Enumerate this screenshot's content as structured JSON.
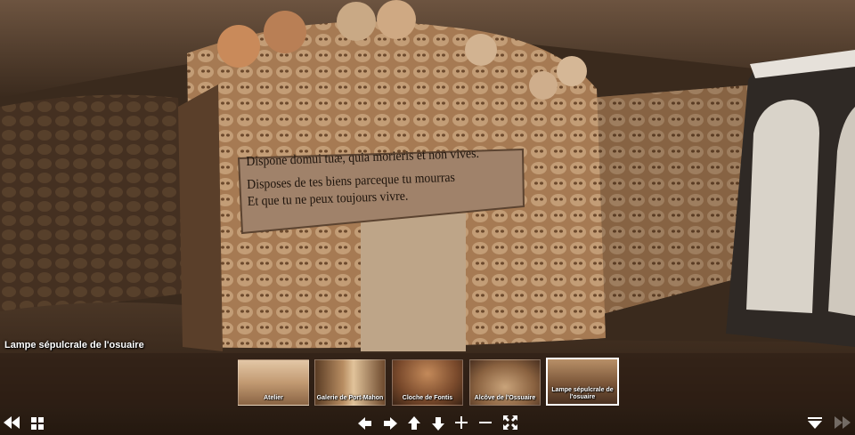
{
  "viewer": {
    "current_title": "Lampe sépulcrale de l'osuaire"
  },
  "plaque": {
    "line1": "Dispone domui tuæ, quia morieris et non vives.",
    "line2": "Disposes de tes biens parceque tu mourras",
    "line3": "Et que tu ne peux toujours vivre."
  },
  "thumbnails": [
    {
      "label": "Atelier"
    },
    {
      "label": "Galerie de Port-Mahon"
    },
    {
      "label": "Cloche de Fontis"
    },
    {
      "label": "Alcôve de l'Ossuaire"
    },
    {
      "label": "Lampe sépulcrale de l'osuaire",
      "active": true
    }
  ],
  "controls": {
    "prev_icon": "double-left-arrow-icon",
    "grid_icon": "grid-icon",
    "left_icon": "arrow-left-icon",
    "right_icon": "arrow-right-icon",
    "up_icon": "arrow-up-icon",
    "down_icon": "arrow-down-icon",
    "zoom_in_icon": "plus-icon",
    "zoom_out_icon": "minus-icon",
    "fullscreen_icon": "fullscreen-icon",
    "hide_icon": "collapse-triangle-icon",
    "next_icon": "double-right-arrow-icon"
  },
  "colors": {
    "bone": "#c9a27a",
    "stone": "#6b5440",
    "shadow": "#2a1d12",
    "plaque": "#9a7a5e"
  }
}
